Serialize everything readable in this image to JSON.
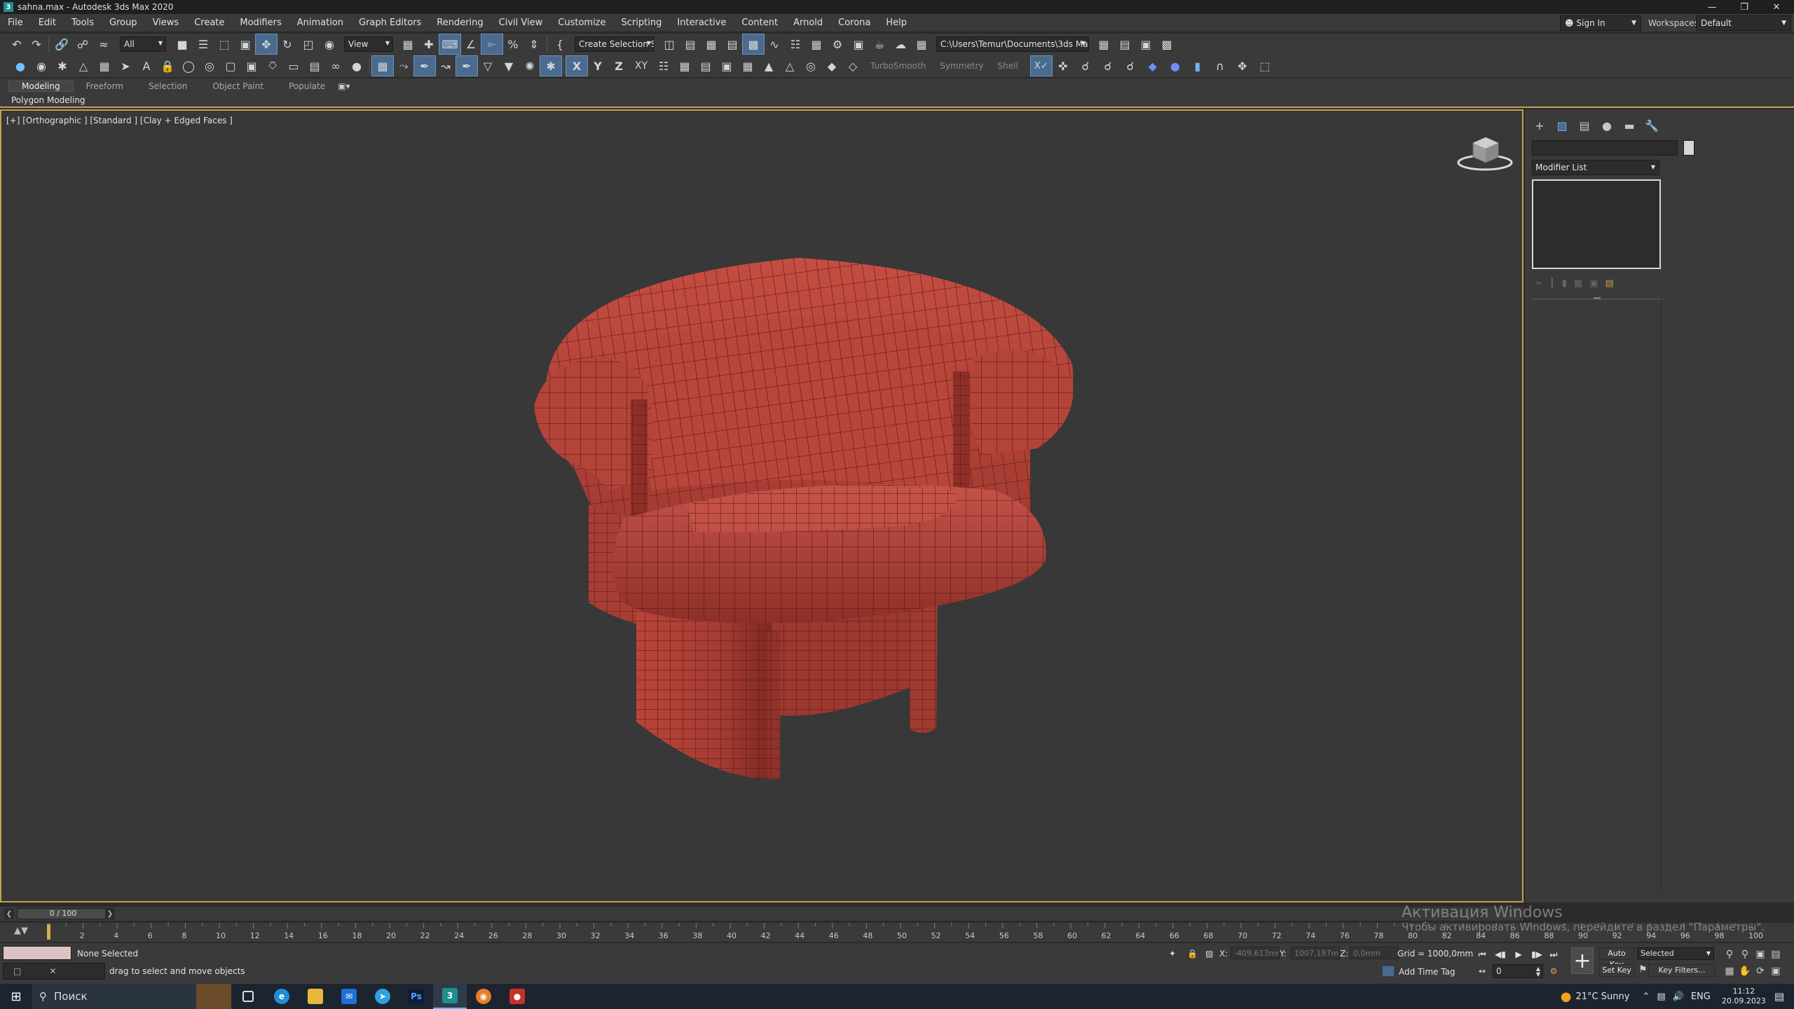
{
  "window": {
    "title": "sahna.max - Autodesk 3ds Max 2020",
    "logo_letter": "3"
  },
  "menu": [
    "File",
    "Edit",
    "Tools",
    "Group",
    "Views",
    "Create",
    "Modifiers",
    "Animation",
    "Graph Editors",
    "Rendering",
    "Civil View",
    "Customize",
    "Scripting",
    "Interactive",
    "Content",
    "Arnold",
    "Corona",
    "Help"
  ],
  "account": {
    "sign_in": "Sign In",
    "workspaces_label": "Workspaces:",
    "workspace": "Default"
  },
  "toolbar": {
    "selection_filter": "All",
    "ref_coord": "View",
    "named_selection": "Create Selection Se",
    "project_path": "C:\\Users\\Temur\\Documents\\3ds Max 2020",
    "axis_x": "X",
    "axis_y": "Y",
    "axis_z": "Z",
    "axis_xy": "XY",
    "turbosmooth": "TurboSmooth",
    "symmetry": "Symmetry",
    "shell": "Shell"
  },
  "ribbon": {
    "tabs": [
      "Modeling",
      "Freeform",
      "Selection",
      "Object Paint",
      "Populate"
    ],
    "active": "Modeling",
    "panel_label": "Polygon Modeling"
  },
  "viewport": {
    "label": "[+] [Orthographic ] [Standard ] [Clay + Edged Faces ]",
    "model_color": "#b2433a",
    "background": "#383838",
    "active_border": "#c8a04e"
  },
  "command_panel": {
    "modifier_list": "Modifier List"
  },
  "timeline": {
    "slider": "0 / 100",
    "ticks": [
      "2",
      "4",
      "6",
      "8",
      "10",
      "12",
      "14",
      "16",
      "18",
      "20",
      "22",
      "24",
      "26",
      "28",
      "30",
      "32",
      "34",
      "36",
      "38",
      "40",
      "42",
      "44",
      "46",
      "48",
      "50",
      "52",
      "54",
      "56",
      "58",
      "60",
      "62",
      "64",
      "66",
      "68",
      "70",
      "72",
      "74",
      "76",
      "78",
      "80",
      "82",
      "84",
      "86",
      "88",
      "90",
      "92",
      "94",
      "96",
      "98",
      "100"
    ]
  },
  "status": {
    "selection": "None Selected",
    "prompt": "drag to select and move objects",
    "x_label": "X:",
    "x_value": "-409,613mm",
    "y_label": "Y:",
    "y_value": "1007,187m",
    "z_label": "Z:",
    "z_value": "0,0mm",
    "grid": "Grid = 1000,0mm",
    "add_time_tag": "Add Time Tag",
    "frame": "0",
    "auto_key": "Auto Key",
    "set_key": "Set Key",
    "key_mode": "Selected",
    "key_filters": "Key Filters..."
  },
  "activation": {
    "title": "Активация Windows",
    "message": "Чтобы активировать Windows, перейдите в раздел \"Параметры\"."
  },
  "taskbar": {
    "search": "Поиск",
    "weather": "21°C  Sunny",
    "lang": "ENG",
    "time": "11:12",
    "date": "20.09.2023"
  }
}
